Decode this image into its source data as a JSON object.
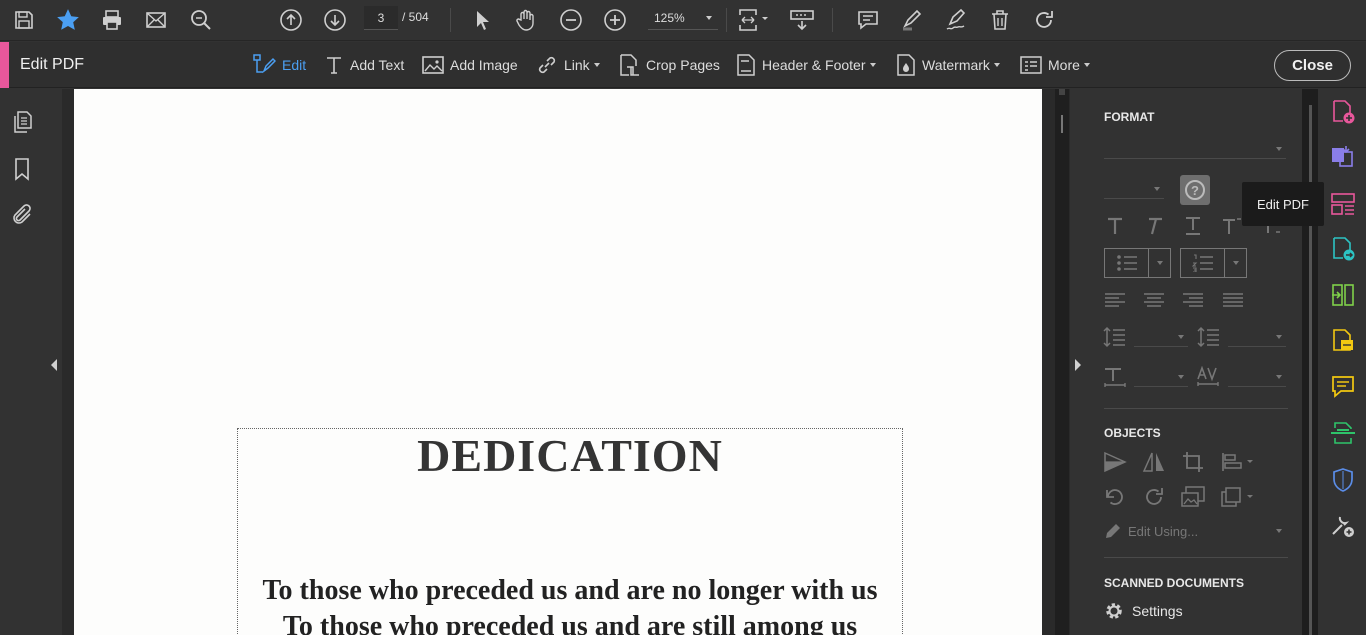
{
  "toolbar": {
    "page_current": "3",
    "page_total": "/  504",
    "zoom": "125%"
  },
  "editbar": {
    "title": "Edit PDF",
    "tools": [
      {
        "label": "Edit"
      },
      {
        "label": "Add Text"
      },
      {
        "label": "Add Image"
      },
      {
        "label": "Link"
      },
      {
        "label": "Crop Pages"
      },
      {
        "label": "Header & Footer"
      },
      {
        "label": "Watermark"
      },
      {
        "label": "More"
      }
    ],
    "close_label": "Close"
  },
  "document": {
    "heading": "DEDICATION",
    "line1": "To those who preceded us and are no longer with us",
    "line2": "To those who preceded us and are still among us"
  },
  "panel": {
    "format_header": "FORMAT",
    "objects_header": "OBJECTS",
    "edit_using": "Edit Using...",
    "scanned_header": "SCANNED DOCUMENTS",
    "settings_label": "Settings",
    "help_glyph": "?"
  },
  "rail": {
    "tooltip": "Edit PDF"
  },
  "colors": {
    "accent_pink": "#e8579b",
    "active_blue": "#4b9ff2"
  }
}
